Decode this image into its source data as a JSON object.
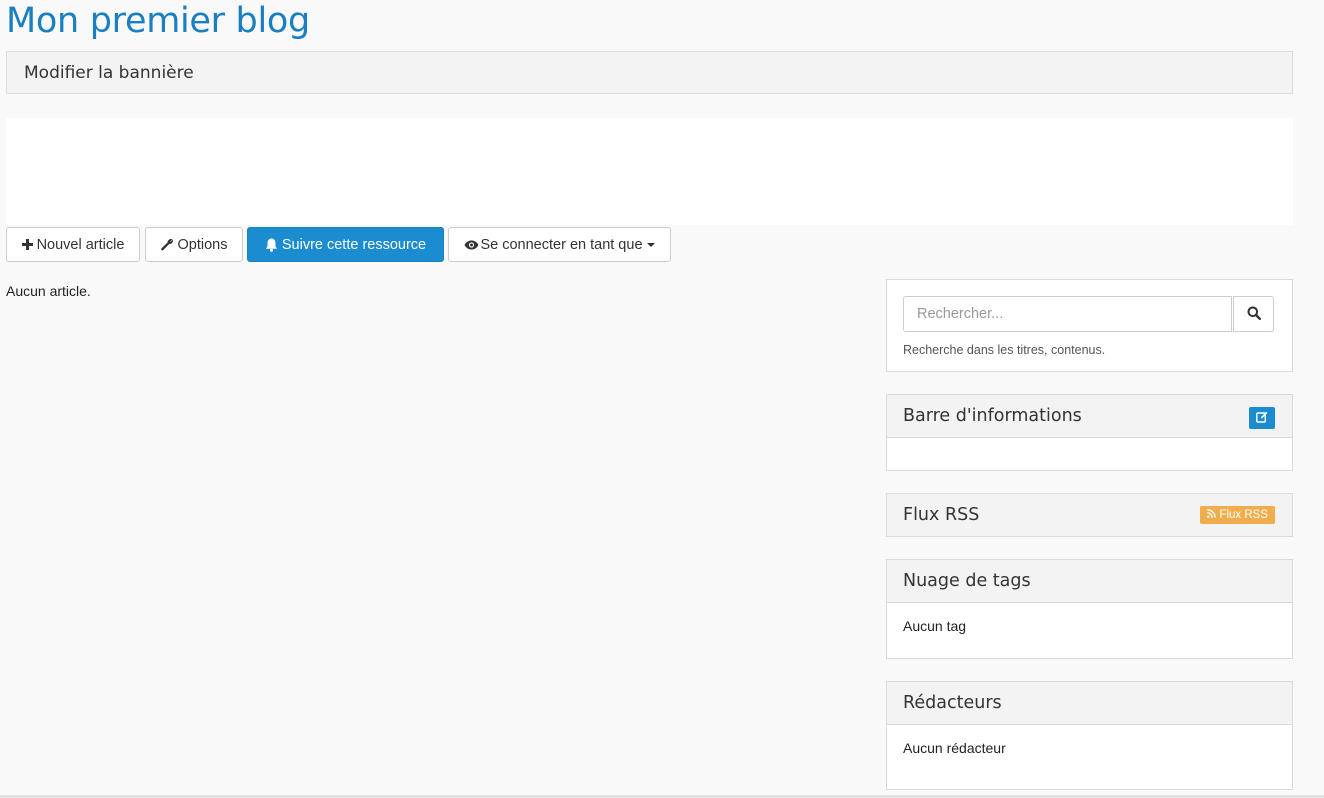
{
  "blog": {
    "title": "Mon premier blog"
  },
  "banner": {
    "edit_label": "Modifier la bannière"
  },
  "toolbar": {
    "new_article_label": "Nouvel article",
    "options_label": "Options",
    "follow_label": "Suivre cette ressource",
    "connect_as_label": "Se connecter en tant que"
  },
  "main": {
    "empty_message": "Aucun article."
  },
  "sidebar": {
    "search": {
      "placeholder": "Rechercher...",
      "help": "Recherche dans les titres, contenus."
    },
    "info_bar": {
      "title": "Barre d'informations"
    },
    "rss": {
      "title": "Flux RSS",
      "badge_label": "Flux RSS"
    },
    "tags": {
      "title": "Nuage de tags",
      "empty": "Aucun tag"
    },
    "authors": {
      "title": "Rédacteurs",
      "empty": "Aucun rédacteur"
    }
  },
  "colors": {
    "accent": "#1a8ccf",
    "title": "#1a7ec2",
    "rss_badge": "#f0ad4e"
  }
}
